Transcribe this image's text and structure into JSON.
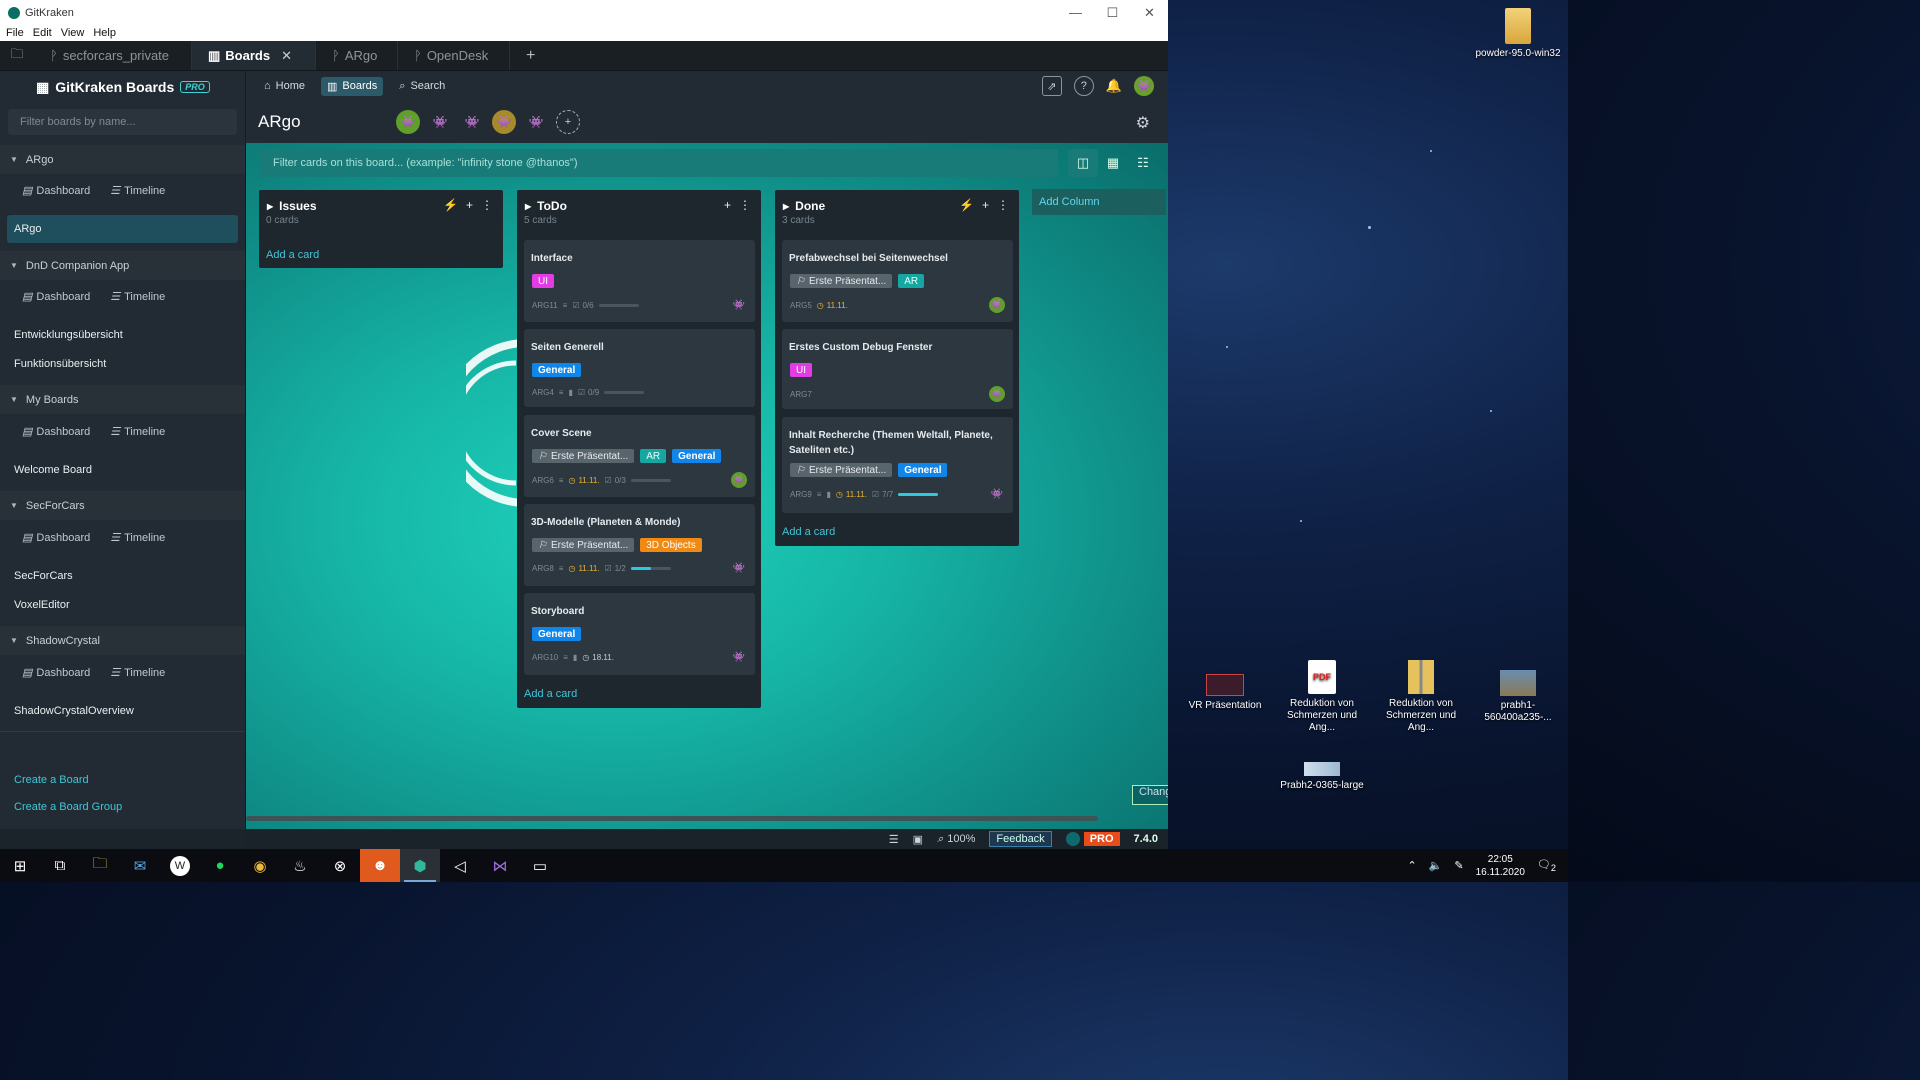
{
  "window": {
    "title": "GitKraken",
    "controls": [
      "—",
      "☐",
      "✕"
    ]
  },
  "menu": [
    "File",
    "Edit",
    "View",
    "Help"
  ],
  "tabs": [
    {
      "label": "secforcars_private",
      "active": false,
      "closable": false
    },
    {
      "label": "Boards",
      "active": true,
      "closable": true
    },
    {
      "label": "ARgo",
      "active": false,
      "closable": false
    },
    {
      "label": "OpenDesk",
      "active": false,
      "closable": false
    }
  ],
  "sidebar": {
    "brand": "GitKraken Boards",
    "pro": "PRO",
    "filter_placeholder": "Filter boards by name...",
    "groups": [
      {
        "name": "ARgo",
        "dashboard": "Dashboard",
        "timeline": "Timeline"
      },
      {
        "name": "DnD Companion App",
        "dashboard": "Dashboard",
        "timeline": "Timeline"
      },
      {
        "name": "My Boards",
        "dashboard": "Dashboard",
        "timeline": "Timeline"
      },
      {
        "name": "SecForCars",
        "dashboard": "Dashboard",
        "timeline": "Timeline"
      },
      {
        "name": "ShadowCrystal",
        "dashboard": "Dashboard",
        "timeline": "Timeline"
      }
    ],
    "boards": {
      "argo": "ARgo",
      "dnd": [
        "Entwicklungsübersicht",
        "Funktionsübersicht"
      ],
      "my": "Welcome Board",
      "secforcars": [
        "SecForCars",
        "VoxelEditor"
      ],
      "shadow": "ShadowCrystalOverview"
    },
    "create_board": "Create a Board",
    "create_group": "Create a Board Group"
  },
  "nav": {
    "home": "Home",
    "boards": "Boards",
    "search": "Search"
  },
  "board": {
    "title": "ARgo",
    "filter_placeholder": "Filter cards on this board... (example: \"infinity stone @thanos\")"
  },
  "columns": [
    {
      "name": "Issues",
      "count": "0 cards",
      "add": "Add a card"
    },
    {
      "name": "ToDo",
      "count": "5 cards",
      "add": "Add a card"
    },
    {
      "name": "Done",
      "count": "3 cards",
      "add": "Add a card"
    }
  ],
  "add_column": "Add Column",
  "cards": {
    "todo": [
      {
        "title": "Interface",
        "labels": [
          "UI"
        ],
        "id": "ARG11",
        "checks": "0/6",
        "progress": 0
      },
      {
        "title": "Seiten Generell",
        "labels": [
          "General"
        ],
        "id": "ARG4",
        "checks": "0/9",
        "progress": 0
      },
      {
        "title": "Cover Scene",
        "labels": [
          "Erste Präsentat...",
          "AR",
          "General"
        ],
        "id": "ARG6",
        "due": "11.11.",
        "checks": "0/3",
        "progress": 0
      },
      {
        "title": "3D-Modelle (Planeten & Monde)",
        "labels": [
          "Erste Präsentat...",
          "3D Objects"
        ],
        "id": "ARG8",
        "due": "11.11.",
        "checks": "1/2",
        "progress": 0.5
      },
      {
        "title": "Storyboard",
        "labels": [
          "General"
        ],
        "id": "ARG10",
        "due": "18.11."
      }
    ],
    "done": [
      {
        "title": "Prefabwechsel bei Seitenwechsel",
        "labels": [
          "Erste Präsentat...",
          "AR"
        ],
        "id": "ARG5",
        "due": "11.11."
      },
      {
        "title": "Erstes Custom Debug Fenster",
        "labels": [
          "UI"
        ],
        "id": "ARG7"
      },
      {
        "title": "Inhalt Recherche (Themen Weltall, Planete, Sateliten etc.)",
        "labels": [
          "Erste Präsentat...",
          "General"
        ],
        "id": "ARG9",
        "due": "11.11.",
        "checks": "7/7",
        "progress": 1
      }
    ]
  },
  "change_btn": "Chang",
  "status": {
    "zoom": "100%",
    "feedback": "Feedback",
    "pro": "PRO",
    "version": "7.4.0"
  },
  "desktop": {
    "icons": [
      "powder-95.0-win32",
      "VR Präsentation",
      "Reduktion von Schmerzen und Ang...",
      "Reduktion von Schmerzen und Ang...",
      "prabh1-560400a235-...",
      "Prabh2-0365-large"
    ]
  },
  "clock": {
    "time": "22:05",
    "date": "16.11.2020",
    "notif": "2"
  },
  "colors": {
    "accent": "#3fc6d8",
    "ui_label": "#e23de4",
    "general_label": "#1186ea",
    "ar_label": "#15a8a3",
    "obj_label": "#f08a14",
    "due": "#f0b429"
  }
}
